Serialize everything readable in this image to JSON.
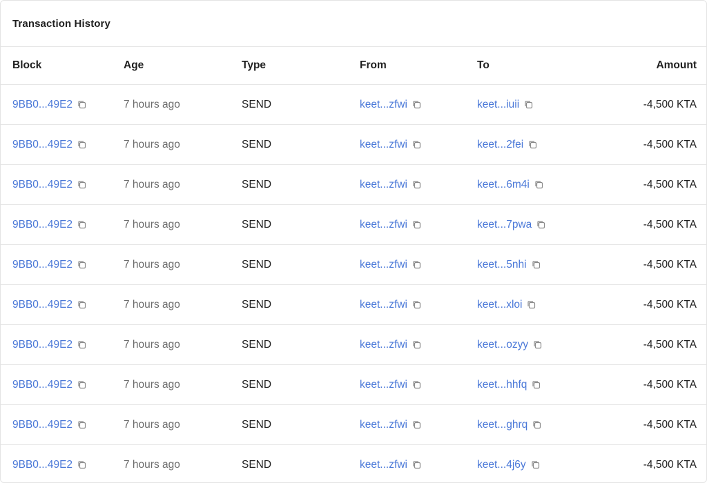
{
  "panel": {
    "title": "Transaction History"
  },
  "table": {
    "headers": {
      "block": "Block",
      "age": "Age",
      "type": "Type",
      "from": "From",
      "to": "To",
      "amount": "Amount"
    },
    "rows": [
      {
        "block": "9BB0...49E2",
        "age": "7 hours ago",
        "type": "SEND",
        "from": "keet...zfwi",
        "to": "keet...iuii",
        "amount": "-4,500 KTA"
      },
      {
        "block": "9BB0...49E2",
        "age": "7 hours ago",
        "type": "SEND",
        "from": "keet...zfwi",
        "to": "keet...2fei",
        "amount": "-4,500 KTA"
      },
      {
        "block": "9BB0...49E2",
        "age": "7 hours ago",
        "type": "SEND",
        "from": "keet...zfwi",
        "to": "keet...6m4i",
        "amount": "-4,500 KTA"
      },
      {
        "block": "9BB0...49E2",
        "age": "7 hours ago",
        "type": "SEND",
        "from": "keet...zfwi",
        "to": "keet...7pwa",
        "amount": "-4,500 KTA"
      },
      {
        "block": "9BB0...49E2",
        "age": "7 hours ago",
        "type": "SEND",
        "from": "keet...zfwi",
        "to": "keet...5nhi",
        "amount": "-4,500 KTA"
      },
      {
        "block": "9BB0...49E2",
        "age": "7 hours ago",
        "type": "SEND",
        "from": "keet...zfwi",
        "to": "keet...xloi",
        "amount": "-4,500 KTA"
      },
      {
        "block": "9BB0...49E2",
        "age": "7 hours ago",
        "type": "SEND",
        "from": "keet...zfwi",
        "to": "keet...ozyy",
        "amount": "-4,500 KTA"
      },
      {
        "block": "9BB0...49E2",
        "age": "7 hours ago",
        "type": "SEND",
        "from": "keet...zfwi",
        "to": "keet...hhfq",
        "amount": "-4,500 KTA"
      },
      {
        "block": "9BB0...49E2",
        "age": "7 hours ago",
        "type": "SEND",
        "from": "keet...zfwi",
        "to": "keet...ghrq",
        "amount": "-4,500 KTA"
      },
      {
        "block": "9BB0...49E2",
        "age": "7 hours ago",
        "type": "SEND",
        "from": "keet...zfwi",
        "to": "keet...4j6y",
        "amount": "-4,500 KTA"
      }
    ]
  },
  "icons": {
    "copy": "copy-icon"
  },
  "colors": {
    "link": "#4a78d8",
    "muted": "#6c6c6c",
    "border": "#e6e6e6"
  }
}
